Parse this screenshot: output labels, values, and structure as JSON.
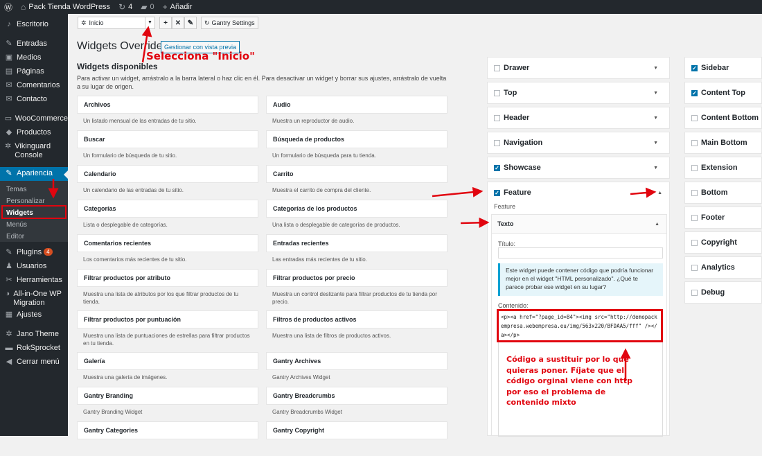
{
  "adminbar": {
    "wp": "W",
    "site": "Pack Tienda WordPress",
    "updates": "4",
    "comments": "0",
    "new": "Añadir"
  },
  "menu": {
    "items": [
      {
        "icon": "♪",
        "label": "Escritorio"
      },
      {
        "icon": "✎",
        "label": "Entradas"
      },
      {
        "icon": "▣",
        "label": "Medios"
      },
      {
        "icon": "▤",
        "label": "Páginas"
      },
      {
        "icon": "✉",
        "label": "Comentarios"
      },
      {
        "icon": "✉",
        "label": "Contacto"
      },
      {
        "icon": "▭",
        "label": "WooCommerce"
      },
      {
        "icon": "◆",
        "label": "Productos"
      },
      {
        "icon": "✲",
        "label": "Vikinguard Console"
      },
      {
        "icon": "✎",
        "label": "Apariencia"
      },
      {
        "icon": "✎",
        "label": "Plugins"
      },
      {
        "icon": "♟",
        "label": "Usuarios"
      },
      {
        "icon": "✂",
        "label": "Herramientas"
      },
      {
        "icon": "◑",
        "label": "All-in-One WP Migration"
      },
      {
        "icon": "▦",
        "label": "Ajustes"
      },
      {
        "icon": "✲",
        "label": "Jano Theme"
      },
      {
        "icon": "▬",
        "label": "RokSprocket"
      },
      {
        "icon": "◀",
        "label": "Cerrar menú"
      }
    ],
    "submenu": [
      "Temas",
      "Personalizar",
      "Widgets",
      "Menús",
      "Editor"
    ],
    "plugins_badge": "4"
  },
  "toolbar": {
    "select": "Inicio",
    "gantry_settings": "Gantry Settings"
  },
  "page": {
    "title": "Widgets Override",
    "preview": "Gestionar con vista previa",
    "available_title": "Widgets disponibles",
    "available_desc": "Para activar un widget, arrástralo a la barra lateral o haz clic en él. Para desactivar un widget y borrar sus ajustes, arrástralo de vuelta a su lugar de origen."
  },
  "widgets_left": [
    {
      "t": "Archivos",
      "d": "Un listado mensual de las entradas de tu sitio."
    },
    {
      "t": "Buscar",
      "d": "Un formulario de búsqueda de tu sitio."
    },
    {
      "t": "Calendario",
      "d": "Un calendario de las entradas de tu sitio."
    },
    {
      "t": "Categorías",
      "d": "Lista o desplegable de categorías."
    },
    {
      "t": "Comentarios recientes",
      "d": "Los comentarios más recientes de tu sitio."
    },
    {
      "t": "Filtrar productos por atributo",
      "d": "Muestra una lista de atributos por los que filtrar productos de tu tienda."
    },
    {
      "t": "Filtrar productos por puntuación",
      "d": "Muestra una lista de puntuaciones de estrellas para filtrar productos en tu tienda."
    },
    {
      "t": "Galería",
      "d": "Muestra una galería de imágenes."
    },
    {
      "t": "Gantry Branding",
      "d": "Gantry Branding Widget"
    },
    {
      "t": "Gantry Categories",
      "d": ""
    }
  ],
  "widgets_right": [
    {
      "t": "Audio",
      "d": "Muestra un reproductor de audio."
    },
    {
      "t": "Búsqueda de productos",
      "d": "Un formulario de búsqueda para tu tienda."
    },
    {
      "t": "Carrito",
      "d": "Muestra el carrito de compra del cliente."
    },
    {
      "t": "Categorías de los productos",
      "d": "Una lista o desplegable de categorías de productos."
    },
    {
      "t": "Entradas recientes",
      "d": "Las entradas más recientes de tu sitio."
    },
    {
      "t": "Filtrar productos por precio",
      "d": "Muestra un control deslizante para filtrar productos de tu tienda por precio."
    },
    {
      "t": "Filtros de productos activos",
      "d": "Muestra una lista de filtros de productos activos."
    },
    {
      "t": "Gantry Archives",
      "d": "Gantry Archives Widget"
    },
    {
      "t": "Gantry Breadcrumbs",
      "d": "Gantry Breadcrumbs Widget"
    },
    {
      "t": "Gantry Copyright",
      "d": ""
    }
  ],
  "areas_mid": [
    {
      "label": "Drawer",
      "checked": false
    },
    {
      "label": "Top",
      "checked": false
    },
    {
      "label": "Header",
      "checked": false
    },
    {
      "label": "Navigation",
      "checked": false
    },
    {
      "label": "Showcase",
      "checked": true
    }
  ],
  "feature": {
    "label": "Feature",
    "desc": "Feature"
  },
  "texto": {
    "title": "Texto",
    "titulo_label": "Título:",
    "notice": "Este widget puede contener código que podría funcionar mejor en el widget \"HTML personalizado\". ¿Qué te parece probar ese widget en su lugar?",
    "contenido_label": "Contenido:",
    "code": "<p><a href=\"?page_id=84\"><img src=\"http://demopackempresa.webempresa.eu/img/563x220/BFDAA5/fff\" /></a></p>"
  },
  "areas_right": [
    {
      "label": "Sidebar",
      "checked": true
    },
    {
      "label": "Content Top",
      "checked": true
    },
    {
      "label": "Content Bottom",
      "checked": false
    },
    {
      "label": "Main Bottom",
      "checked": false
    },
    {
      "label": "Extension",
      "checked": false
    },
    {
      "label": "Bottom",
      "checked": false
    },
    {
      "label": "Footer",
      "checked": false
    },
    {
      "label": "Copyright",
      "checked": false
    },
    {
      "label": "Analytics",
      "checked": false
    },
    {
      "label": "Debug",
      "checked": false
    }
  ],
  "annotations": {
    "select": "Selecciona \"Inicio\"",
    "code": "Código a sustituir por lo que quieras poner. Fíjate que el código orginal viene con http por eso el problema de contenido mixto"
  },
  "colors": {
    "accent": "#0073aa",
    "annotation": "#e1050f",
    "sidebar": "#23282d"
  }
}
